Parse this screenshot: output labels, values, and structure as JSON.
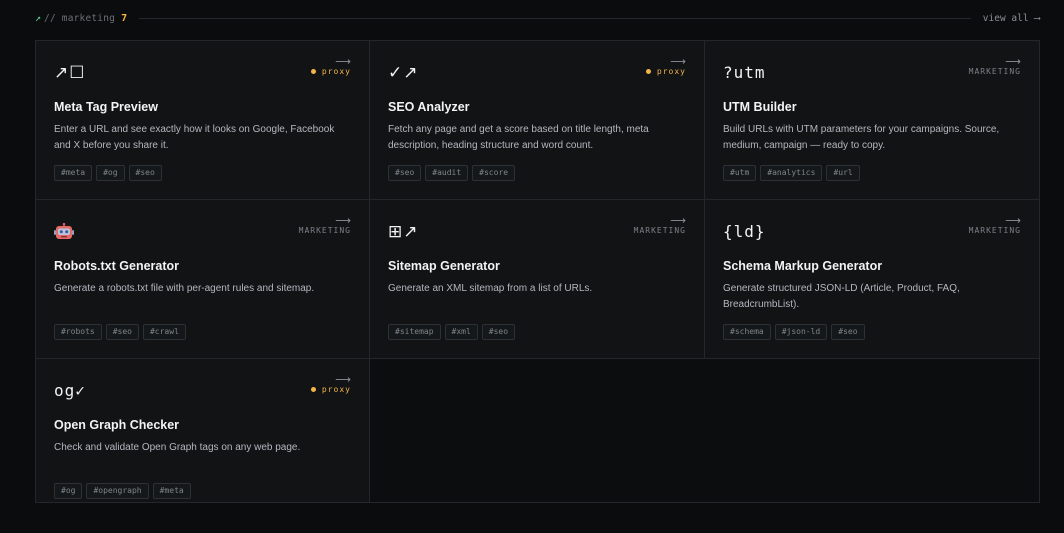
{
  "header": {
    "arrow": "↗",
    "label": "// marketing",
    "count": "7",
    "view_all": "view all ⟶"
  },
  "cards": [
    {
      "icon": "↗☐",
      "badge": "proxy",
      "title": "Meta Tag Preview",
      "desc": "Enter a URL and see exactly how it looks on Google, Facebook and X before you share it.",
      "tags": [
        "#meta",
        "#og",
        "#seo"
      ]
    },
    {
      "icon": "✓↗",
      "badge": "proxy",
      "title": "SEO Analyzer",
      "desc": "Fetch any page and get a score based on title length, meta description, heading structure and word count.",
      "tags": [
        "#seo",
        "#audit",
        "#score"
      ]
    },
    {
      "icon": "?utm",
      "badge": "MARKETING",
      "title": "UTM Builder",
      "desc": "Build URLs with UTM parameters for your campaigns. Source, medium, campaign — ready to copy.",
      "tags": [
        "#utm",
        "#analytics",
        "#url"
      ]
    },
    {
      "icon": "robot",
      "badge": "MARKETING",
      "title": "Robots.txt Generator",
      "desc": "Generate a robots.txt file with per-agent rules and sitemap.",
      "tags": [
        "#robots",
        "#seo",
        "#crawl"
      ]
    },
    {
      "icon": "⊞↗",
      "badge": "MARKETING",
      "title": "Sitemap Generator",
      "desc": "Generate an XML sitemap from a list of URLs.",
      "tags": [
        "#sitemap",
        "#xml",
        "#seo"
      ]
    },
    {
      "icon": "{ld}",
      "badge": "MARKETING",
      "title": "Schema Markup Generator",
      "desc": "Generate structured JSON-LD (Article, Product, FAQ, BreadcrumbList).",
      "tags": [
        "#schema",
        "#json-ld",
        "#seo"
      ]
    },
    {
      "icon": "og✓",
      "badge": "proxy",
      "title": "Open Graph Checker",
      "desc": "Check and validate Open Graph tags on any web page.",
      "tags": [
        "#og",
        "#opengraph",
        "#meta"
      ]
    }
  ],
  "colors": {
    "accent_proxy": "#f3b548",
    "accent_arrow": "#5ed39a",
    "background": "#0b0c0d",
    "card": "#111315"
  }
}
